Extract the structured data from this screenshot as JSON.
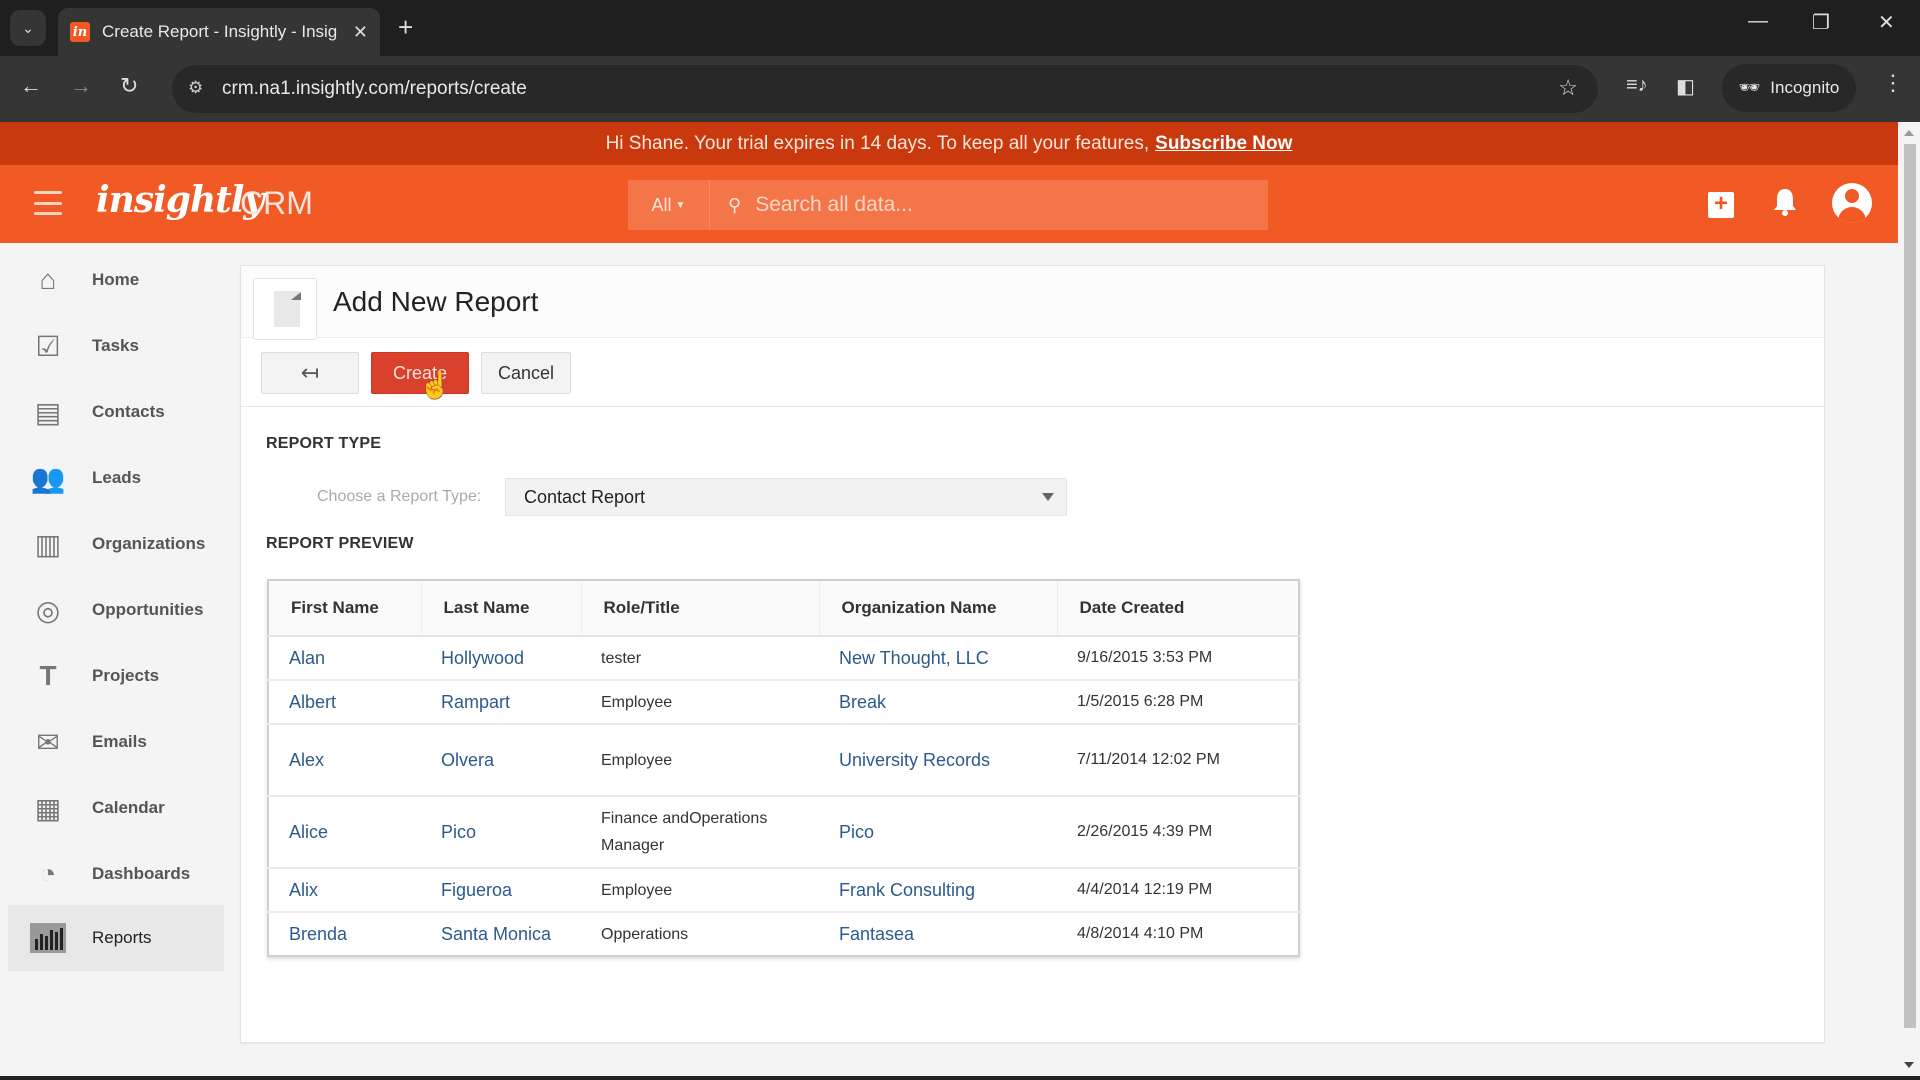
{
  "browser": {
    "tab_title": "Create Report - Insightly - Insig",
    "tab_favicon": "in",
    "url": "crm.na1.insightly.com/reports/create",
    "incognito_label": "Incognito",
    "icons": {
      "tab_dropdown": "⌄",
      "tab_close": "✕",
      "new_tab": "+",
      "minimize": "—",
      "restore": "❐",
      "close": "✕",
      "back": "←",
      "forward": "→",
      "reload": "↻",
      "site_info": "⚙",
      "bookmark": "☆",
      "media": "≡♪",
      "sidepanel": "◧",
      "incognito": "🕶",
      "menu": "⋮"
    }
  },
  "banner": {
    "message": "Hi Shane. Your trial expires in 14 days. To keep all your features,",
    "link_label": "Subscribe Now"
  },
  "header": {
    "logo": "insightly",
    "product": "CRM",
    "search_scope": "All",
    "search_placeholder": "Search all data...",
    "icons": {
      "search": "⚲",
      "add": "+",
      "bell": "🔔"
    }
  },
  "sidebar": {
    "items": [
      {
        "label": "Home",
        "icon": "⌂",
        "active": false
      },
      {
        "label": "Tasks",
        "icon": "☑",
        "active": false
      },
      {
        "label": "Contacts",
        "icon": "▤",
        "active": false
      },
      {
        "label": "Leads",
        "icon": "👥",
        "active": false
      },
      {
        "label": "Organizations",
        "icon": "▥",
        "active": false
      },
      {
        "label": "Opportunities",
        "icon": "◎",
        "active": false
      },
      {
        "label": "Projects",
        "icon": "T",
        "active": false
      },
      {
        "label": "Emails",
        "icon": "✉",
        "active": false
      },
      {
        "label": "Calendar",
        "icon": "▦",
        "active": false
      },
      {
        "label": "Dashboards",
        "icon": "◔",
        "active": false
      },
      {
        "label": "Reports",
        "icon": "▮",
        "active": true
      }
    ]
  },
  "page": {
    "title": "Add New Report",
    "buttons": {
      "back": "↤",
      "create": "Create",
      "cancel": "Cancel"
    },
    "report_type_heading": "REPORT TYPE",
    "report_type_label": "Choose a Report Type:",
    "report_type_value": "Contact Report",
    "preview_heading": "REPORT PREVIEW",
    "table": {
      "columns": [
        "First Name",
        "Last Name",
        "Role/Title",
        "Organization Name",
        "Date Created"
      ],
      "rows": [
        {
          "first": "Alan",
          "last": "Hollywood",
          "role": "tester",
          "org": "New Thought, LLC",
          "date": "9/16/2015 3:53 PM"
        },
        {
          "first": "Albert",
          "last": "Rampart",
          "role": "Employee",
          "org": "Break",
          "date": "1/5/2015 6:28 PM"
        },
        {
          "first": "Alex",
          "last": "Olvera",
          "role": "Employee",
          "org": "University Records",
          "date": "7/11/2014 12:02 PM"
        },
        {
          "first": "Alice",
          "last": "Pico",
          "role": "Finance andOperations Manager",
          "org": "Pico",
          "date": "2/26/2015 4:39 PM"
        },
        {
          "first": "Alix",
          "last": "Figueroa",
          "role": "Employee",
          "org": "Frank Consulting",
          "date": "4/4/2014 12:19 PM"
        },
        {
          "first": "Brenda",
          "last": "Santa Monica",
          "role": "Opperations",
          "org": "Fantasea",
          "date": "4/8/2014 4:10 PM"
        }
      ]
    }
  },
  "colors": {
    "brand_orange": "#F15A24",
    "banner_orange": "#C9390D",
    "create_button": "#D9412D",
    "link_blue": "#2D5A8E"
  }
}
